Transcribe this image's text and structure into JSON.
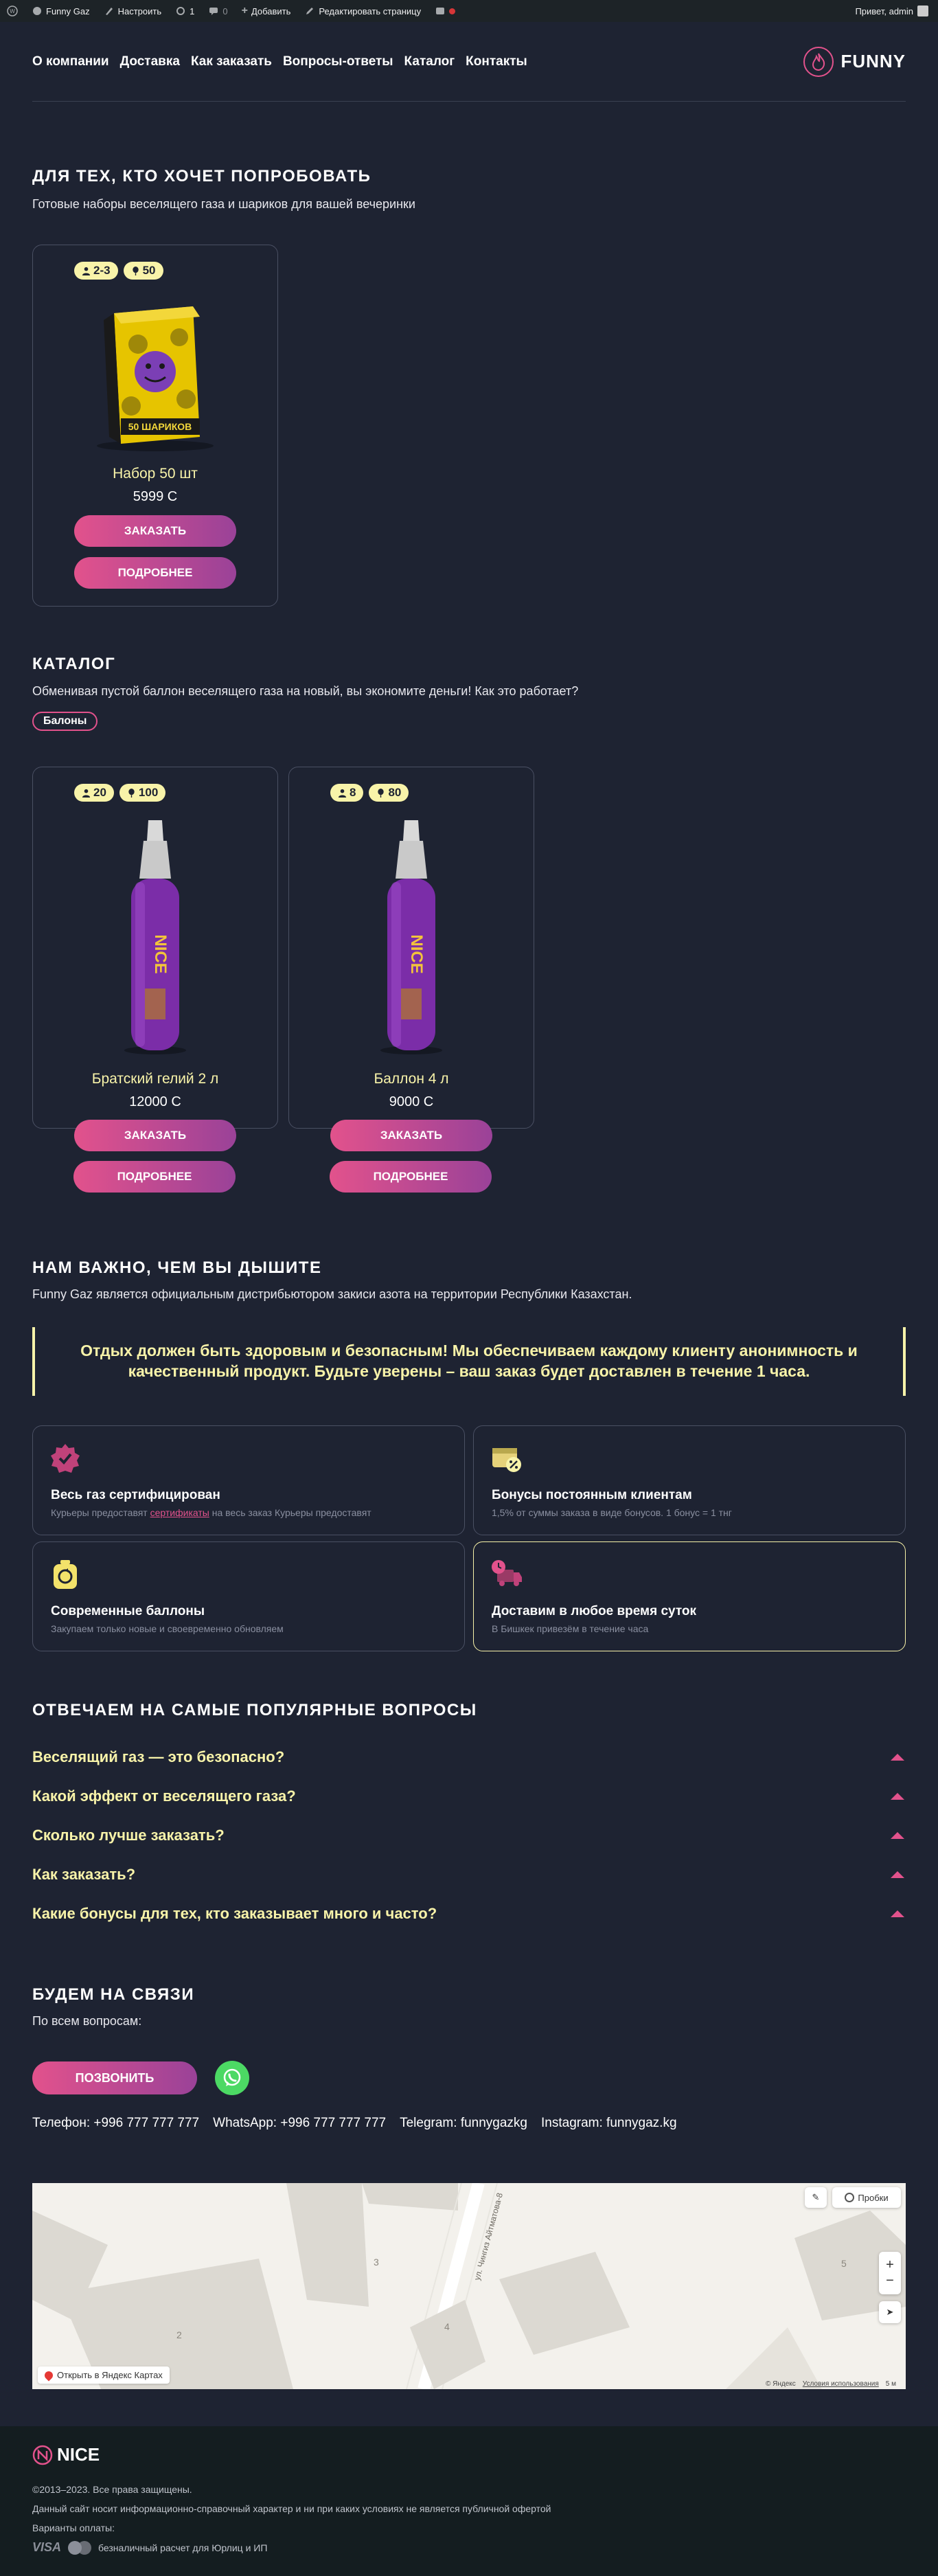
{
  "adminbar": {
    "site": "Funny Gaz",
    "customize": "Настроить",
    "updates": "1",
    "comments": "0",
    "add": "Добавить",
    "edit": "Редактировать страницу",
    "greeting": "Привет, admin"
  },
  "nav": {
    "items": [
      "О компании",
      "Доставка",
      "Как заказать",
      "Вопросы-ответы",
      "Каталог",
      "Контакты"
    ],
    "logo": "FUNNY"
  },
  "try_section": {
    "title": "ДЛЯ ТЕХ, КТО ХОЧЕТ ПОПРОБОВАТЬ",
    "subtitle": "Готовые наборы веселящего газа и шариков для вашей вечеринки"
  },
  "products_try": [
    {
      "people": "2-3",
      "balloons": "50",
      "name": "Набор 50 шт",
      "price": "5999 С",
      "box_text": "50 ШАРИКОВ"
    }
  ],
  "catalog": {
    "title": "КАТАЛОГ",
    "subtitle": "Обменивая пустой баллон веселящего газа на новый, вы экономите деньги! Как это работает?",
    "tag": "Балоны"
  },
  "products_catalog": [
    {
      "people": "20",
      "balloons": "100",
      "name": "Братский гелий 2 л",
      "price": "12000 С",
      "brand": "NICE"
    },
    {
      "people": "8",
      "balloons": "80",
      "name": "Баллон 4 л",
      "price": "9000 С",
      "brand": "NICE"
    }
  ],
  "buttons": {
    "order": "ЗАКАЗАТЬ",
    "more": "ПОДРОБНЕЕ",
    "call": "ПОЗВОНИТЬ"
  },
  "breath": {
    "title": "НАМ ВАЖНО, ЧЕМ ВЫ ДЫШИТЕ",
    "subtitle": "Funny Gaz является официальным дистрибьютором закиси азота на территории Республики Казахстан.",
    "quote": "Отдых должен быть здоровым и безопасным! Мы обеспечиваем каждому клиенту анонимность и качественный продукт. Будьте уверены – ваш заказ будет доставлен в течение 1 часа."
  },
  "features": [
    {
      "title": "Весь газ сертифицирован",
      "desc_before": "Курьеры предоставят ",
      "desc_link": "сертификаты",
      "desc_after": " на весь заказ Курьеры предоставят"
    },
    {
      "title": "Бонусы постоянным клиентам",
      "desc_before": "1,5% от суммы заказа в виде бонусов. 1 бонус = 1 тнг",
      "desc_link": "",
      "desc_after": ""
    },
    {
      "title": "Современные баллоны",
      "desc_before": "Закупаем только новые и своевременно обновляем",
      "desc_link": "",
      "desc_after": ""
    },
    {
      "title": "Доставим в любое время суток",
      "desc_before": "В Бишкек привезём в течение часа",
      "desc_link": "",
      "desc_after": ""
    }
  ],
  "faq": {
    "title": "ОТВЕЧАЕМ НА САМЫЕ ПОПУЛЯРНЫЕ ВОПРОСЫ",
    "items": [
      "Веселящий газ — это безопасно?",
      "Какой эффект от веселящего газа?",
      "Сколько лучше заказать?",
      "Как заказать?",
      "Какие бонусы для тех, кто заказывает много и часто?"
    ]
  },
  "contact": {
    "title": "БУДЕМ НА СВЯЗИ",
    "subtitle": "По всем вопросам:",
    "phone_label": "Телефон:",
    "phone": "+996 777 777 777",
    "wa_label": "WhatsApp:",
    "wa": "+996 777 777 777",
    "tg_label": "Telegram:",
    "tg": "funnygazkg",
    "ig_label": "Instagram:",
    "ig": "funnygaz.kg"
  },
  "map": {
    "traffic": "Пробки",
    "open": "Открыть в Яндекс Картах",
    "street": "ул. Чингиз Айтматова-8",
    "buildings": [
      "2",
      "3",
      "4",
      "5"
    ],
    "copyright": "© Яндекс",
    "terms": "Условия использования",
    "scale": "5 м"
  },
  "footer": {
    "logo": "NICE",
    "copyright": "©2013–2023. Все права защищены.",
    "disclaimer": "Данный сайт носит информационно-справочный характер и ни при каких условиях не является публичной офертой",
    "payment_label": "Варианты оплаты:",
    "visa": "VISA",
    "payment_note": "безналичный расчет для Юрлиц и ИП"
  },
  "colors": {
    "bg": "#1e2332",
    "accent": "#e2528c",
    "yellow": "#f8f3a9",
    "purple": "#9a4298"
  }
}
